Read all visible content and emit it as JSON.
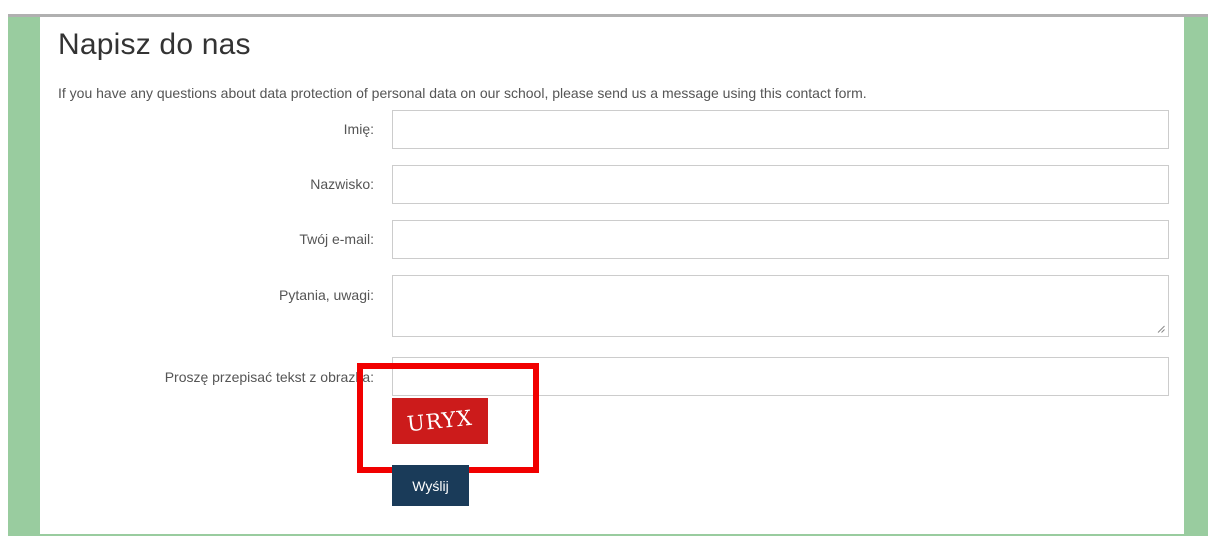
{
  "form": {
    "title": "Napisz do nas",
    "intro": "If you have any questions about data protection of personal data on our school, please send us a message using this contact form.",
    "fields": {
      "first_name_label": "Imię:",
      "last_name_label": "Nazwisko:",
      "email_label": "Twój e-mail:",
      "message_label": "Pytania, uwagi:",
      "captcha_label": "Proszę przepisać tekst z obrazka:",
      "first_name_value": "",
      "last_name_value": "",
      "email_value": "",
      "message_value": "",
      "captcha_value": ""
    },
    "captcha_text": "URYX",
    "submit_label": "Wyślij"
  },
  "colors": {
    "frame_green": "#99cc9f",
    "captcha_red": "#cc1b1b",
    "button_navy": "#1a3b59",
    "highlight_red": "#f10000"
  }
}
